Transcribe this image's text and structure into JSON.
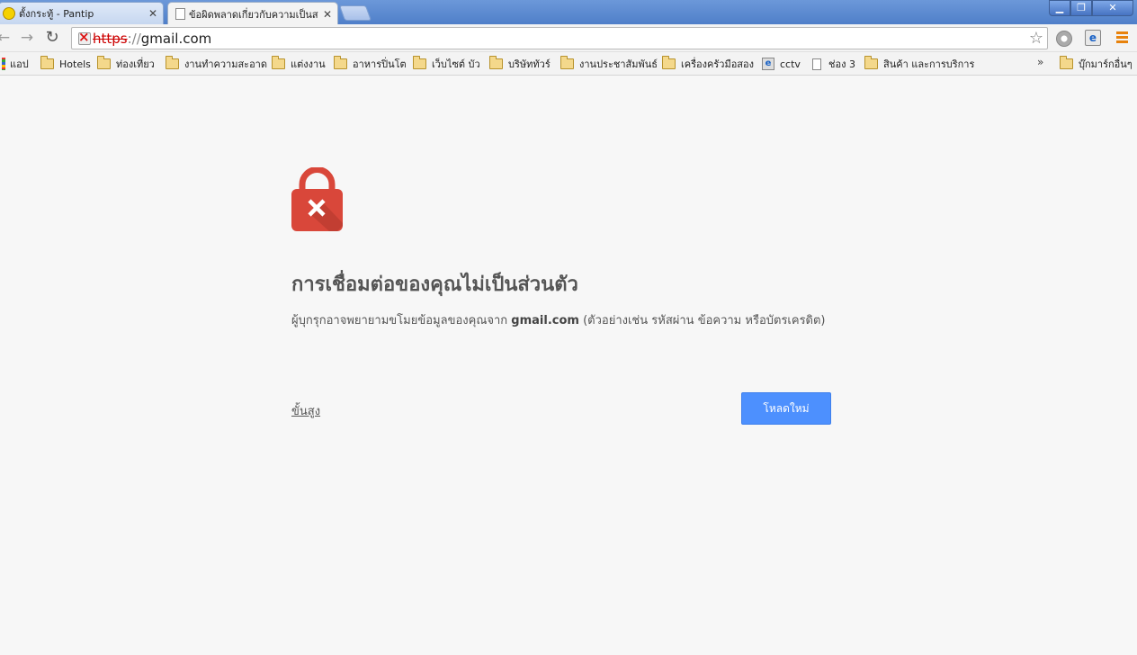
{
  "tabs": [
    {
      "title": "ตั้งกระทู้ - Pantip",
      "active": false
    },
    {
      "title": "ข้อผิดพลาดเกี่ยวกับความเป็นส",
      "active": true
    }
  ],
  "omnibox": {
    "scheme": "https",
    "separator": "://",
    "host": "gmail.com"
  },
  "bookmarks": {
    "apps": "แอป",
    "items": [
      "Hotels",
      "ท่องเที่ยว",
      "งานทำความสะอาด",
      "แต่งงาน",
      "อาหารปิ่นโต",
      "เว็บไซต์ บัว",
      "บริษัททัวร์",
      "งานประชาสัมพันธ์",
      "เครื่องครัวมือสอง",
      "cctv",
      "ช่อง 3",
      "สินค้า และการบริการ"
    ],
    "overflow": "»",
    "other": "บุ๊กมาร์กอื่นๆ"
  },
  "interstitial": {
    "heading": "การเชื่อมต่อของคุณไม่เป็นส่วนตัว",
    "desc_before": "ผู้บุกรุกอาจพยายามขโมยข้อมูลของคุณจาก ",
    "desc_host": "gmail.com",
    "desc_after": " (ตัวอย่างเช่น รหัสผ่าน ข้อความ หรือบัตรเครดิต)",
    "advanced_label": "ขั้นสูง",
    "reload_label": "โหลดใหม่"
  },
  "colors": {
    "lock_red": "#d9473a",
    "button_blue": "#4d90fe",
    "background": "#f7f7f7"
  }
}
